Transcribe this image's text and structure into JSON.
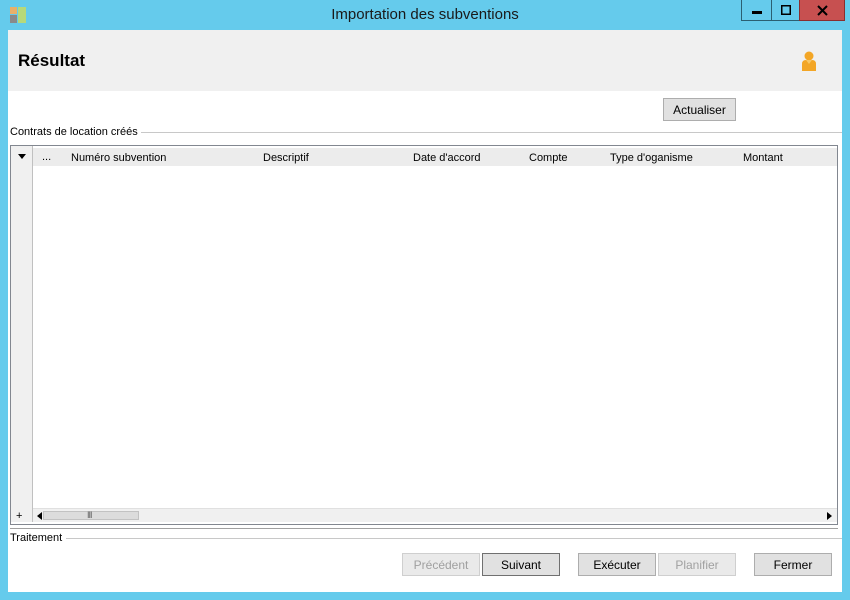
{
  "window": {
    "title": "Importation des subventions",
    "controls": {
      "minimize": "▬",
      "maximize": "□",
      "close": "✕"
    },
    "accent": "#65cbec"
  },
  "header": {
    "title": "Résultat",
    "icon": "person-icon"
  },
  "refresh_button": "Actualiser",
  "contracts_group": {
    "label": "Contrats de location créés",
    "grid": {
      "selector_column": "...",
      "columns": [
        "Numéro subvention",
        "Descriptif",
        "Date d'accord",
        "Compte",
        "Type d'oganisme",
        "Montant"
      ],
      "rows": [],
      "add_row_symbol": "+"
    }
  },
  "processing_group": {
    "label": "Traitement"
  },
  "footer": {
    "previous": "Précédent",
    "next": "Suivant",
    "execute": "Exécuter",
    "schedule": "Planifier",
    "close": "Fermer"
  }
}
